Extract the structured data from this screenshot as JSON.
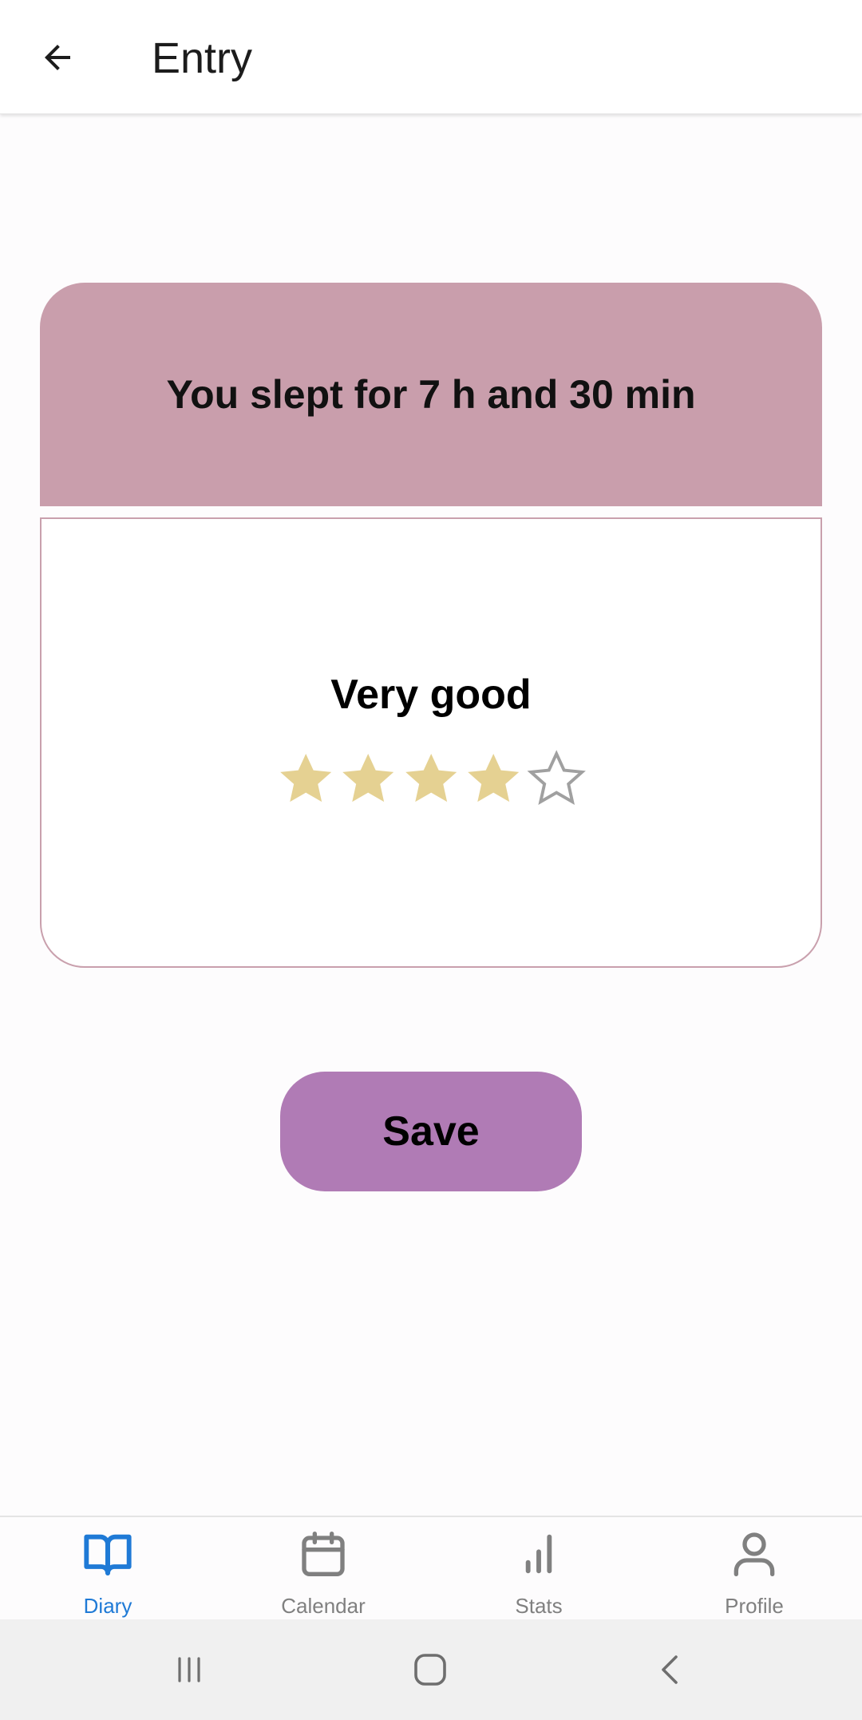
{
  "app_bar": {
    "title": "Entry",
    "back_icon": "arrow-back-icon"
  },
  "sleep_summary": {
    "text": "You slept for 7 h and 30 min"
  },
  "rating": {
    "label": "Very good",
    "value": 4,
    "max": 5,
    "filled_color": "#e5d192",
    "empty_color": "#a0a0a0"
  },
  "save_button": {
    "label": "Save"
  },
  "bottom_nav": {
    "items": [
      {
        "label": "Diary",
        "icon": "book-icon",
        "active": true
      },
      {
        "label": "Calendar",
        "icon": "calendar-icon",
        "active": false
      },
      {
        "label": "Stats",
        "icon": "bar-chart-icon",
        "active": false
      },
      {
        "label": "Profile",
        "icon": "person-icon",
        "active": false
      }
    ],
    "active_color": "#1f7ad6",
    "inactive_color": "#808080"
  },
  "colors": {
    "summary_card": "#c99eac",
    "card_border": "#c9a0ad",
    "save_button": "#b07bb5"
  }
}
